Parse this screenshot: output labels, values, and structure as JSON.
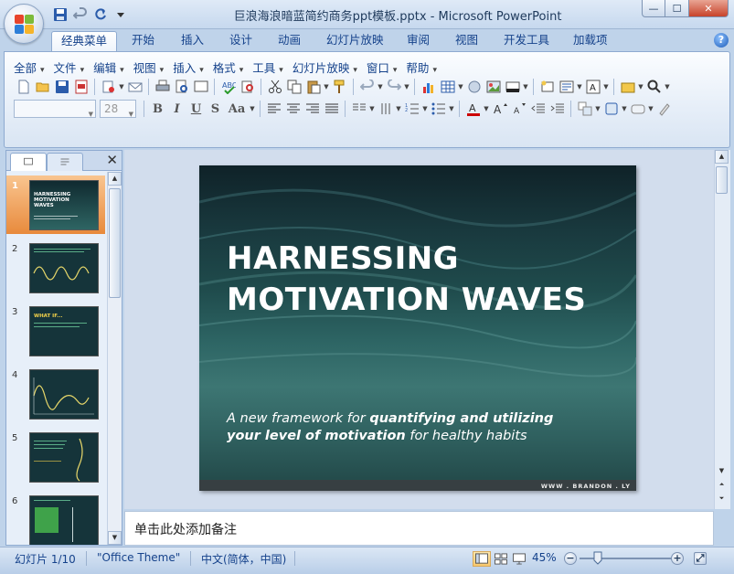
{
  "window": {
    "title": "巨浪海浪暗蓝简约商务ppt模板.pptx - Microsoft PowerPoint",
    "controls": {
      "minimize": "—",
      "maximize": "☐",
      "close": "✕"
    }
  },
  "quick_access": {
    "icons": [
      "save-icon",
      "undo-icon",
      "redo-icon",
      "customize-icon"
    ]
  },
  "tabs": [
    "经典菜单",
    "开始",
    "插入",
    "设计",
    "动画",
    "幻灯片放映",
    "审阅",
    "视图",
    "开发工具",
    "加载项"
  ],
  "active_tab": "经典菜单",
  "help_label": "?",
  "menu": [
    "全部",
    "文件",
    "编辑",
    "视图",
    "插入",
    "格式",
    "工具",
    "幻灯片放映",
    "窗口",
    "帮助"
  ],
  "format_bar": {
    "font_name": "",
    "font_size": "28",
    "letters": [
      "B",
      "I",
      "U",
      "S",
      "Aa"
    ]
  },
  "slides_pane": {
    "close_label": "✕",
    "thumbnails": [
      {
        "number": "1",
        "title": "HARNESSING MOTIVATION WAVES",
        "selected": true
      },
      {
        "number": "2",
        "title": "",
        "selected": false
      },
      {
        "number": "3",
        "title": "WHAT IF...",
        "selected": false
      },
      {
        "number": "4",
        "title": "",
        "selected": false
      },
      {
        "number": "5",
        "title": "",
        "selected": false
      },
      {
        "number": "6",
        "title": "",
        "selected": false
      }
    ]
  },
  "slide": {
    "title_line1": "HARNESSING",
    "title_line2": "MOTIVATION WAVES",
    "subtitle_a": "A new framework for ",
    "subtitle_b": "quantifying and utilizing",
    "subtitle_c": "your level of motivation",
    "subtitle_d": " for healthy habits",
    "brand": "WWW . BRANDON . LY"
  },
  "notes_placeholder": "单击此处添加备注",
  "status": {
    "slide_info": "幻灯片 1/10",
    "theme": "\"Office Theme\"",
    "language": "中文(简体，中国)",
    "zoom": "45%"
  },
  "colors": {
    "accent": "#15428b",
    "selected_thumb": "#e88a3c",
    "slide_bg": "#1f4b4c"
  }
}
